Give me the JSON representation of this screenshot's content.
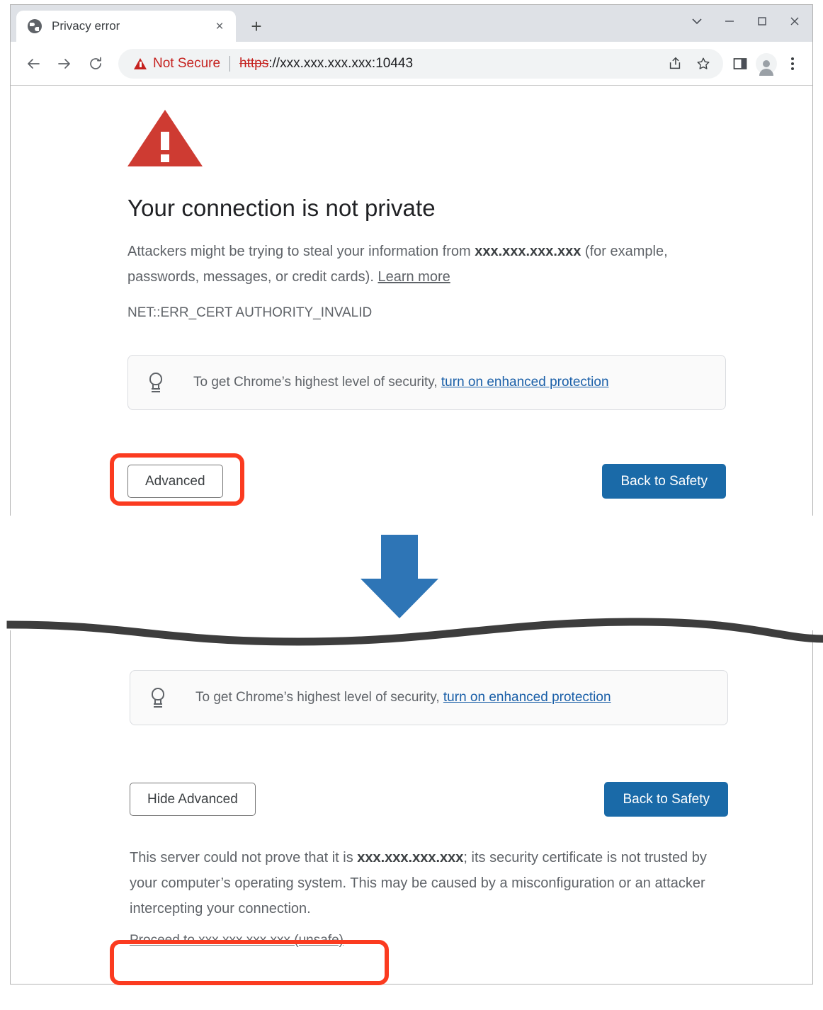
{
  "window": {
    "tab": {
      "title": "Privacy error",
      "favicon": "globe-icon",
      "close": "×"
    },
    "new_tab_label": "+",
    "controls": {
      "tab_search": "∨",
      "minimize": "−",
      "maximize": "□",
      "close": "×"
    },
    "toolbar": {
      "back": "←",
      "forward": "→",
      "reload": "⟳",
      "security_label": "Not Secure",
      "url_scheme": "https",
      "url_rest": "://xxx.xxx.xxx.xxx:10443",
      "share_icon": "share-icon",
      "bookmark_icon": "star-icon",
      "side_panel_icon": "side-panel-icon",
      "profile_icon": "profile-avatar",
      "menu_icon": "three-dot-menu"
    }
  },
  "error_page": {
    "icon": "warning-triangle-icon",
    "title": "Your connection is not private",
    "body_prefix": "Attackers might be trying to steal your information from ",
    "body_host": "xxx.xxx.xxx.xxx",
    "body_suffix": " (for example, passwords, messages, or credit cards). ",
    "learn_more": "Learn more",
    "error_code": "NET::ERR_CERT AUTHORITY_INVALID",
    "tip": {
      "icon": "lightbulb-icon",
      "text": "To get Chrome’s highest level of security, ",
      "link": "turn on enhanced protection"
    },
    "buttons": {
      "advanced": "Advanced",
      "back_to_safety": "Back to Safety"
    }
  },
  "expanded_page": {
    "tip": {
      "icon": "lightbulb-icon",
      "text": "To get Chrome’s highest level of security, ",
      "link": "turn on enhanced protection"
    },
    "buttons": {
      "hide_advanced": "Hide Advanced",
      "back_to_safety": "Back to Safety"
    },
    "detail_prefix": "This server could not prove that it is ",
    "detail_host": "xxx.xxx.xxx.xxx",
    "detail_suffix": "; its security certificate is not trusted by your computer’s operating system. This may be caused by a misconfiguration or an attacker intercepting your connection.",
    "proceed_link": "Proceed to xxx.xxx.xxx.xxx (unsafe)"
  },
  "annotations": {
    "arrow": "blue-down-arrow",
    "highlight_advanced": "red-rounded-rect",
    "highlight_proceed": "red-rounded-rect",
    "accent_red": "#fb3b20",
    "accent_blue": "#2e75b6",
    "button_blue": "#1a6aa8",
    "warning_red": "#ce3b32"
  }
}
